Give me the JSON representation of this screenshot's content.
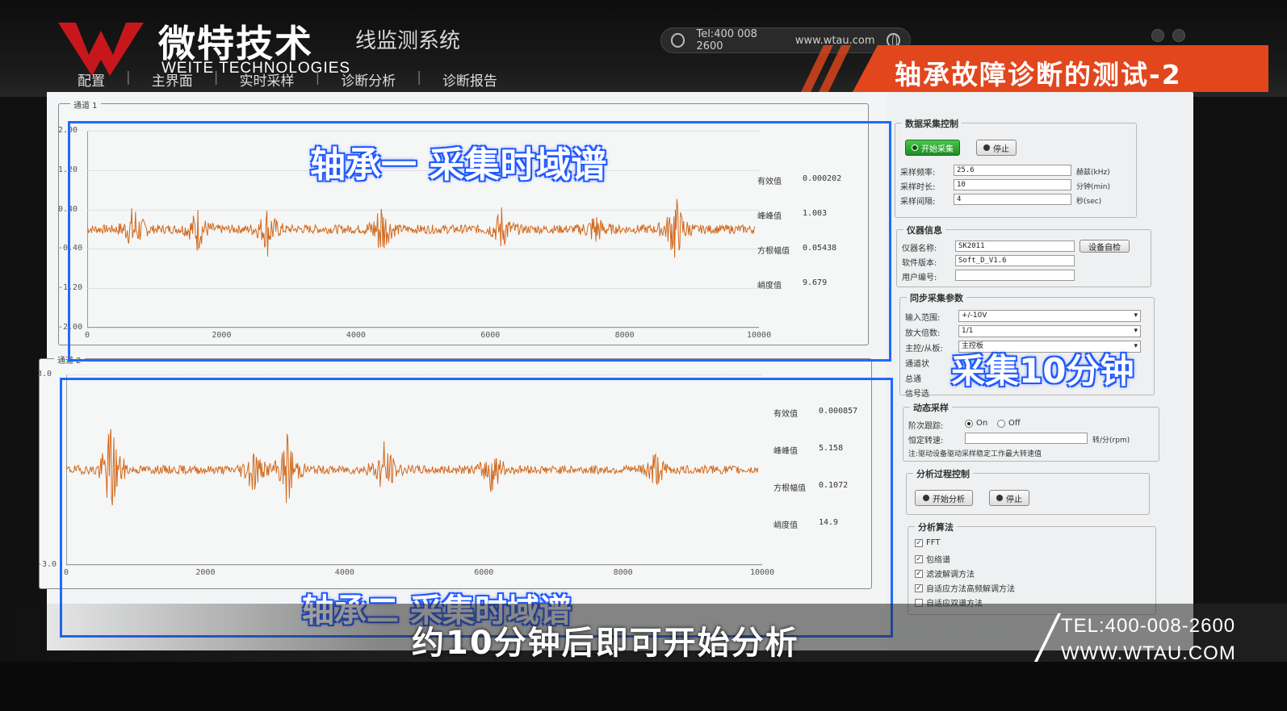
{
  "brand": {
    "cn": "微特技术",
    "en": "WEITE TECHNOLOGIES",
    "app_title": "线监测系统",
    "contact_pill_tel": "Tel:400 008 2600",
    "contact_pill_web": "www.wtau.com"
  },
  "menu": {
    "items": [
      "配置",
      "主界面",
      "实时采样",
      "诊断分析",
      "诊断报告"
    ]
  },
  "title_banner": "轴承故障诊断的测试-2",
  "overlays": {
    "bearing1": "轴承一 采集时域谱",
    "bearing2": "轴承二 采集时域谱",
    "collect": "采集10分钟"
  },
  "chart_data": [
    {
      "type": "line",
      "title": "",
      "frame_label": "通道 1",
      "yticks": [
        "2.00",
        "1.20",
        "0.40",
        "-0.40",
        "-1.20",
        "-2.00"
      ],
      "xticks": [
        "0",
        "2000",
        "4000",
        "6000",
        "8000",
        "10000"
      ],
      "ylim": [
        -2.0,
        2.0
      ],
      "xlim": [
        0,
        10000
      ],
      "color": "#d2691e",
      "burst_positions": [
        700,
        1650,
        2700,
        4400,
        6200,
        7600,
        8800
      ],
      "burst_amplitudes": [
        0.55,
        0.45,
        0.5,
        0.65,
        0.45,
        0.35,
        0.75
      ],
      "stats": [
        {
          "label": "有效值",
          "value": "0.000202"
        },
        {
          "label": "峰峰值",
          "value": "1.003"
        },
        {
          "label": "方根幅值",
          "value": "0.05438"
        },
        {
          "label": "峭度值",
          "value": "9.679"
        }
      ]
    },
    {
      "type": "line",
      "title": "",
      "frame_label": "通道 2",
      "yticks": [
        "3.0",
        "-3.0"
      ],
      "xticks": [
        "0",
        "2000",
        "4000",
        "6000",
        "8000",
        "10000"
      ],
      "ylim": [
        -3.0,
        3.0
      ],
      "xlim": [
        0,
        10000
      ],
      "color": "#d2691e",
      "burst_positions": [
        650,
        2700,
        3200,
        4600,
        6150,
        8500
      ],
      "burst_amplitudes": [
        1.7,
        0.75,
        1.2,
        1.0,
        0.8,
        0.6
      ],
      "stats": [
        {
          "label": "有效值",
          "value": "0.000857"
        },
        {
          "label": "峰峰值",
          "value": "5.158"
        },
        {
          "label": "方根幅值",
          "value": "0.1072"
        },
        {
          "label": "峭度值",
          "value": "14.9"
        }
      ]
    }
  ],
  "panel": {
    "acq": {
      "title": "数据采集控制",
      "start": "开始采集",
      "stop": "停止",
      "freq_label": "采样频率:",
      "freq_value": "25.6",
      "freq_unit": "赫兹(kHz)",
      "dur_label": "采样时长:",
      "dur_value": "10",
      "dur_unit": "分钟(min)",
      "interval_label": "采样间隔:",
      "interval_value": "4",
      "interval_unit": "秒(sec)"
    },
    "device": {
      "title": "仪器信息",
      "name_label": "仪器名称:",
      "name_value": "SK2011",
      "self_check": "设备自检",
      "sw_label": "软件版本:",
      "sw_value": "Soft_D_V1.6",
      "user_label": "用户编号:",
      "user_value": ""
    },
    "sync": {
      "title": "同步采集参数",
      "range_label": "输入范围:",
      "range_value": "+/-10V",
      "gain_label": "放大倍数:",
      "gain_value": "1/1",
      "mode_label": "主控/从板:",
      "mode_value": "主控板",
      "ch_state_label": "通道状",
      "total_ch_label": "总通",
      "signal_label": "信号选"
    },
    "dynamic": {
      "title": "动态采样",
      "track_label": "阶次跟踪:",
      "on": "On",
      "off": "Off",
      "speed_label": "恒定转速:",
      "speed_unit": "转/分(rpm)",
      "note": "注:驱动设备驱动采样稳定工作最大转速值"
    },
    "analysis": {
      "title": "分析过程控制",
      "start": "开始分析",
      "stop": "停止"
    },
    "algo": {
      "title": "分析算法",
      "items": [
        {
          "label": "FFT",
          "checked": true
        },
        {
          "label": "包络谱",
          "checked": true
        },
        {
          "label": "滤波解调方法",
          "checked": true
        },
        {
          "label": "自适应方法高频解调方法",
          "checked": true
        },
        {
          "label": "自适应双谱方法",
          "checked": false
        }
      ]
    }
  },
  "subtitle": "约10分钟后即可开始分析",
  "contact": {
    "tel": "TEL:400-008-2600",
    "web": "WWW.WTAU.COM"
  },
  "colors": {
    "accent_orange": "#e2461d",
    "brand_red": "#c8171c",
    "highlight_blue": "#1e6bff",
    "wave": "#d2691e"
  }
}
